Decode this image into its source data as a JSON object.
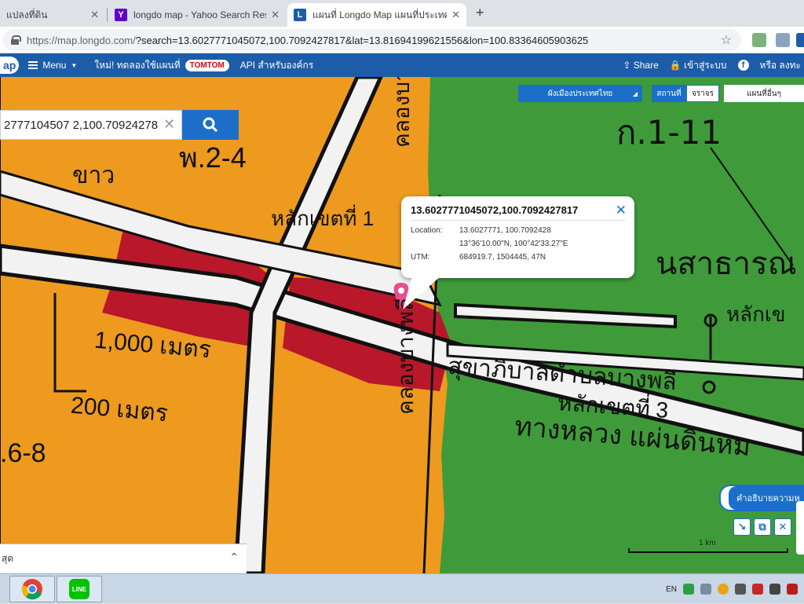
{
  "browser": {
    "tabs": [
      {
        "label": "แปลงที่ดิน"
      },
      {
        "label": "longdo map - Yahoo Search Res"
      },
      {
        "label": "แผนที่ Longdo Map แผนที่ประเทศไ"
      }
    ],
    "url_host": "https://map.longdo.com/",
    "url_rest": "?search=13.6027771045072,100.7092427817&lat=13.81694199621556&lon=100.83364605903625"
  },
  "header": {
    "logo": "ap",
    "menu_label": "Menu",
    "promo_text": "ใหม่! ทดลองใช้แผนที่",
    "promo_brand": "TOMTOM",
    "api_link": "API สำหรับองค์กร",
    "share_label": "Share",
    "login_label": "เข้าสู่ระบบ",
    "or_label": "หรือ ลงทะ"
  },
  "search": {
    "value": "2777104507 2,100.70924278"
  },
  "layers": {
    "select_label": "ผังเมืองประเทศไทย",
    "seg_label": "สถานที่",
    "traffic_label": "จราจร",
    "other_label": "แผนที่อื่นๆ"
  },
  "popup": {
    "title": "13.6027771045072,100.7092427817",
    "rows": [
      {
        "k": "Location:",
        "v": "13.6027771, 100.7092428"
      },
      {
        "k": "",
        "v": "13°36'10.00\"N, 100°42'33.27\"E"
      },
      {
        "k": "UTM:",
        "v": "684919.7, 1504445, 47N"
      }
    ]
  },
  "legend_label": "คำอธิบายความห",
  "scale_label": "1 km",
  "bottom_panel_text": "สุด",
  "map_labels": {
    "l1": "ก.1-11",
    "l2": "พ.2-4",
    "l3": "ขาว",
    "l4": "1,000 เมตร",
    "l5": "200 เมตร",
    "l6": ".6-8",
    "l7": "คลองบางพลี",
    "l8": "หลักเขตที่ 1",
    "l9": "นสาธารณ",
    "l10": "หลักเข",
    "l11": "หลักเขตที่ 3",
    "l12": "ทางหลวง แผ่นดินหม",
    "l13": "คลองบางพลี",
    "l14": "สุขาภิบาลตำบลบางพลี"
  },
  "taskbar": {
    "lang": "EN"
  },
  "colors": {
    "orange_zone": "#ed9a1f",
    "green_zone": "#3f9b3a",
    "red_zone": "#b8182a",
    "brand_blue": "#1c6fc9"
  }
}
